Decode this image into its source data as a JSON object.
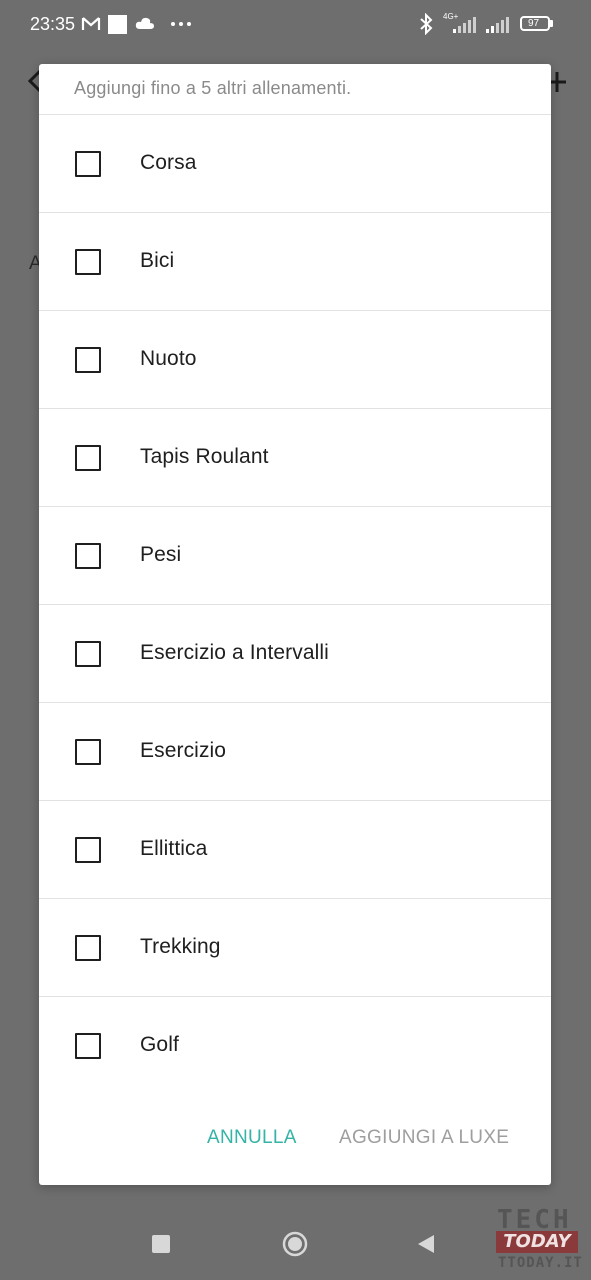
{
  "status_bar": {
    "time": "23:35",
    "battery": "97",
    "network": "4G+",
    "icons": [
      "gmail-icon",
      "square-notification-icon",
      "cloud-icon",
      "more-dots-icon",
      "bluetooth-icon",
      "signal-icon",
      "signal-icon",
      "battery-icon"
    ]
  },
  "background": {
    "partial_letter": "A"
  },
  "dialog": {
    "subtitle": "Aggiungi fino a 5 altri allenamenti.",
    "workouts": [
      {
        "label": "Corsa",
        "checked": false
      },
      {
        "label": "Bici",
        "checked": false
      },
      {
        "label": "Nuoto",
        "checked": false
      },
      {
        "label": "Tapis Roulant",
        "checked": false
      },
      {
        "label": "Pesi",
        "checked": false
      },
      {
        "label": "Esercizio a Intervalli",
        "checked": false
      },
      {
        "label": "Esercizio",
        "checked": false
      },
      {
        "label": "Ellittica",
        "checked": false
      },
      {
        "label": "Trekking",
        "checked": false
      },
      {
        "label": "Golf",
        "checked": false
      }
    ],
    "cancel_label": "ANNULLA",
    "add_label": "AGGIUNGI A LUXE"
  },
  "colors": {
    "accent": "#35b3a6",
    "disabled_button": "#9e9e9e",
    "scrim": "#6e6e6e"
  },
  "watermark": {
    "line1": "TECH",
    "line2": "TODAY",
    "line3": "TTODAY.IT"
  }
}
